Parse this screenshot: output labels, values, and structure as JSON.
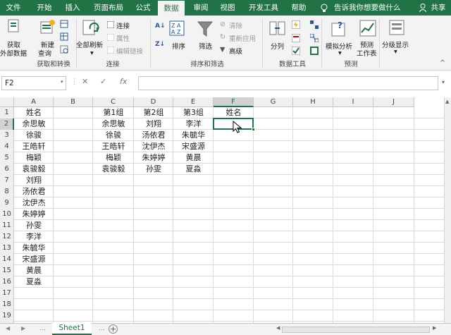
{
  "tabs": [
    "文件",
    "开始",
    "插入",
    "页面布局",
    "公式",
    "数据",
    "审阅",
    "视图",
    "开发工具",
    "帮助"
  ],
  "active_tab": "数据",
  "tell_me": "告诉我你想要做什么",
  "share": "共享",
  "ribbon": {
    "get_data": [
      "获取",
      "外部数据"
    ],
    "new_query": [
      "新建",
      "查询"
    ],
    "group_get": "获取和转换",
    "refresh_all": "全部刷新",
    "connections": "连接",
    "properties": "属性",
    "edit_links": "编辑链接",
    "group_conn": "连接",
    "sort": "排序",
    "filter": "筛选",
    "clear": "清除",
    "reapply": "重新应用",
    "advanced": "高级",
    "group_sort": "排序和筛选",
    "split": "分列",
    "group_tools": "数据工具",
    "what_if": "模拟分析",
    "forecast": [
      "预测",
      "工作表"
    ],
    "group_forecast": "预测",
    "outline": "分级显示"
  },
  "formula_bar": {
    "name_box": "F2",
    "fx": "fx",
    "value": ""
  },
  "columns": [
    "A",
    "B",
    "C",
    "D",
    "E",
    "F",
    "G",
    "H",
    "I",
    "J"
  ],
  "rows": [
    "1",
    "2",
    "3",
    "4",
    "5",
    "6",
    "7",
    "8",
    "9",
    "10",
    "11",
    "12",
    "13",
    "14",
    "15",
    "16",
    "17",
    "18",
    "19",
    "20",
    "21"
  ],
  "col_a": [
    "姓名",
    "余思敏",
    "徐骏",
    "王皓轩",
    "梅颖",
    "袁骏毅",
    "刘翔",
    "汤依君",
    "沈伊杰",
    "朱婷婷",
    "孙雯",
    "李洋",
    "朱毓华",
    "宋盛源",
    "黄晨",
    "夏淼"
  ],
  "col_c": [
    "第1组",
    "余思敏",
    "徐骏",
    "王皓轩",
    "梅颖",
    "袁骏毅"
  ],
  "col_d": [
    "第2组",
    "刘翔",
    "汤依君",
    "沈伊杰",
    "朱婷婷",
    "孙雯"
  ],
  "col_e": [
    "第3组",
    "李洋",
    "朱毓华",
    "宋盛源",
    "黄晨",
    "夏淼"
  ],
  "f1": "姓名",
  "sheet_tab": "Sheet1",
  "colors": {
    "brand": "#217346",
    "grid": "#dadada",
    "header": "#efefef"
  }
}
